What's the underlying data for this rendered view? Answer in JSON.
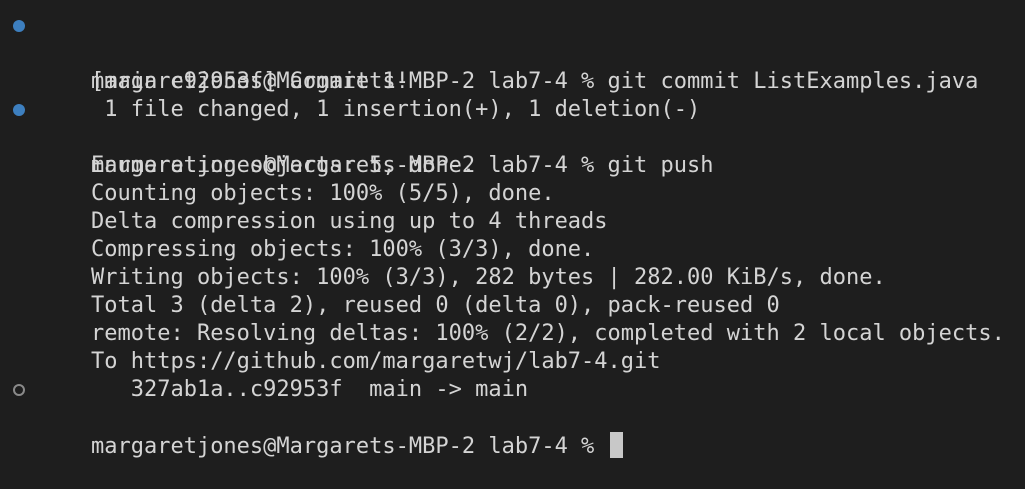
{
  "terminal": {
    "lines": [
      {
        "decoration": "filled",
        "text": "margaretjones@Margarets-MBP-2 lab7-4 % git commit ListExamples.java"
      },
      {
        "decoration": "none",
        "text": "[main c92953f] Commit 1!"
      },
      {
        "decoration": "none",
        "text": " 1 file changed, 1 insertion(+), 1 deletion(-)"
      },
      {
        "decoration": "filled",
        "text": "margaretjones@Margarets-MBP-2 lab7-4 % git push"
      },
      {
        "decoration": "none",
        "text": "Enumerating objects: 5, done."
      },
      {
        "decoration": "none",
        "text": "Counting objects: 100% (5/5), done."
      },
      {
        "decoration": "none",
        "text": "Delta compression using up to 4 threads"
      },
      {
        "decoration": "none",
        "text": "Compressing objects: 100% (3/3), done."
      },
      {
        "decoration": "none",
        "text": "Writing objects: 100% (3/3), 282 bytes | 282.00 KiB/s, done."
      },
      {
        "decoration": "none",
        "text": "Total 3 (delta 2), reused 0 (delta 0), pack-reused 0"
      },
      {
        "decoration": "none",
        "text": "remote: Resolving deltas: 100% (2/2), completed with 2 local objects."
      },
      {
        "decoration": "none",
        "text": "To https://github.com/margaretwj/lab7-4.git"
      },
      {
        "decoration": "none",
        "text": "   327ab1a..c92953f  main -> main"
      },
      {
        "decoration": "hollow",
        "text": "margaretjones@Margarets-MBP-2 lab7-4 % "
      }
    ]
  },
  "colors": {
    "background": "#1e1e1e",
    "text": "#d4d4d4",
    "decoration_success": "#3d7fbf",
    "decoration_pending": "#8a8a8a",
    "cursor": "#c8c8c8"
  }
}
